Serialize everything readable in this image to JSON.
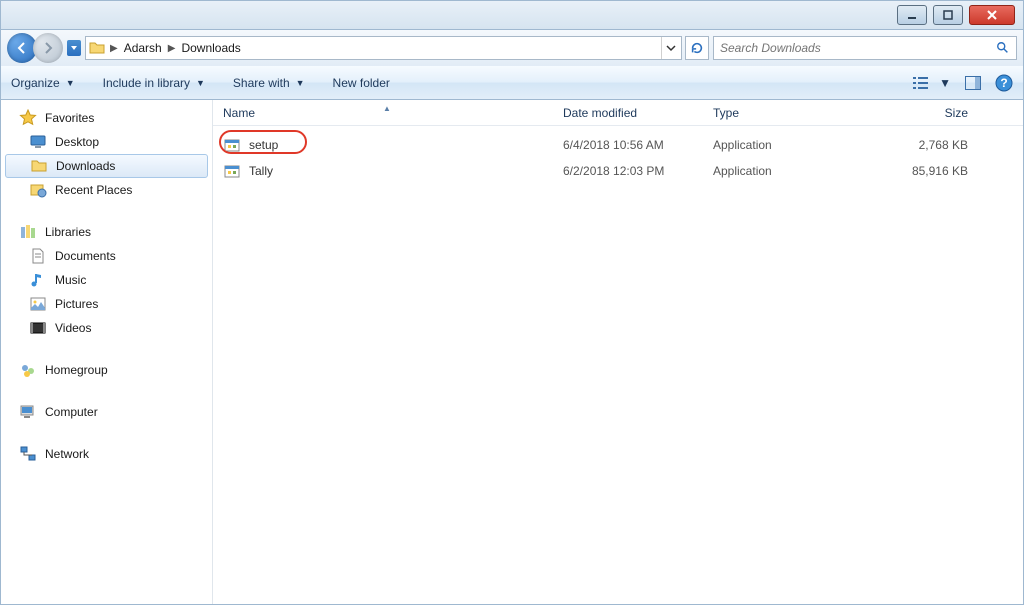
{
  "breadcrumb": {
    "segments": [
      "Adarsh",
      "Downloads"
    ]
  },
  "search": {
    "placeholder": "Search Downloads"
  },
  "toolbar": {
    "organize": "Organize",
    "include": "Include in library",
    "share": "Share with",
    "newfolder": "New folder"
  },
  "sidebar": {
    "favorites": {
      "label": "Favorites",
      "items": [
        {
          "label": "Desktop",
          "icon": "desktop"
        },
        {
          "label": "Downloads",
          "icon": "folder",
          "selected": true
        },
        {
          "label": "Recent Places",
          "icon": "recent"
        }
      ]
    },
    "libraries": {
      "label": "Libraries",
      "items": [
        {
          "label": "Documents",
          "icon": "doc"
        },
        {
          "label": "Music",
          "icon": "music"
        },
        {
          "label": "Pictures",
          "icon": "pic"
        },
        {
          "label": "Videos",
          "icon": "vid"
        }
      ]
    },
    "homegroup": {
      "label": "Homegroup"
    },
    "computer": {
      "label": "Computer"
    },
    "network": {
      "label": "Network"
    }
  },
  "columns": {
    "name": "Name",
    "date": "Date modified",
    "type": "Type",
    "size": "Size"
  },
  "files": [
    {
      "name": "setup",
      "date": "6/4/2018 10:56 AM",
      "type": "Application",
      "size": "2,768 KB",
      "highlighted": true
    },
    {
      "name": "Tally",
      "date": "6/2/2018 12:03 PM",
      "type": "Application",
      "size": "85,916 KB"
    }
  ]
}
